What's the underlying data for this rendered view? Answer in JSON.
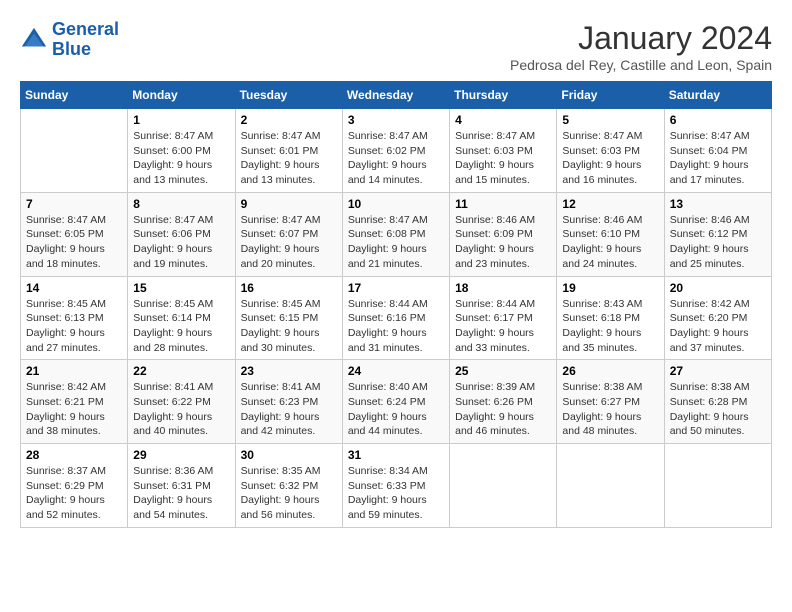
{
  "header": {
    "logo_line1": "General",
    "logo_line2": "Blue",
    "month": "January 2024",
    "location": "Pedrosa del Rey, Castille and Leon, Spain"
  },
  "days_of_week": [
    "Sunday",
    "Monday",
    "Tuesday",
    "Wednesday",
    "Thursday",
    "Friday",
    "Saturday"
  ],
  "weeks": [
    [
      {
        "day": "",
        "info": ""
      },
      {
        "day": "1",
        "info": "Sunrise: 8:47 AM\nSunset: 6:00 PM\nDaylight: 9 hours\nand 13 minutes."
      },
      {
        "day": "2",
        "info": "Sunrise: 8:47 AM\nSunset: 6:01 PM\nDaylight: 9 hours\nand 13 minutes."
      },
      {
        "day": "3",
        "info": "Sunrise: 8:47 AM\nSunset: 6:02 PM\nDaylight: 9 hours\nand 14 minutes."
      },
      {
        "day": "4",
        "info": "Sunrise: 8:47 AM\nSunset: 6:03 PM\nDaylight: 9 hours\nand 15 minutes."
      },
      {
        "day": "5",
        "info": "Sunrise: 8:47 AM\nSunset: 6:03 PM\nDaylight: 9 hours\nand 16 minutes."
      },
      {
        "day": "6",
        "info": "Sunrise: 8:47 AM\nSunset: 6:04 PM\nDaylight: 9 hours\nand 17 minutes."
      }
    ],
    [
      {
        "day": "7",
        "info": "Sunrise: 8:47 AM\nSunset: 6:05 PM\nDaylight: 9 hours\nand 18 minutes."
      },
      {
        "day": "8",
        "info": "Sunrise: 8:47 AM\nSunset: 6:06 PM\nDaylight: 9 hours\nand 19 minutes."
      },
      {
        "day": "9",
        "info": "Sunrise: 8:47 AM\nSunset: 6:07 PM\nDaylight: 9 hours\nand 20 minutes."
      },
      {
        "day": "10",
        "info": "Sunrise: 8:47 AM\nSunset: 6:08 PM\nDaylight: 9 hours\nand 21 minutes."
      },
      {
        "day": "11",
        "info": "Sunrise: 8:46 AM\nSunset: 6:09 PM\nDaylight: 9 hours\nand 23 minutes."
      },
      {
        "day": "12",
        "info": "Sunrise: 8:46 AM\nSunset: 6:10 PM\nDaylight: 9 hours\nand 24 minutes."
      },
      {
        "day": "13",
        "info": "Sunrise: 8:46 AM\nSunset: 6:12 PM\nDaylight: 9 hours\nand 25 minutes."
      }
    ],
    [
      {
        "day": "14",
        "info": "Sunrise: 8:45 AM\nSunset: 6:13 PM\nDaylight: 9 hours\nand 27 minutes."
      },
      {
        "day": "15",
        "info": "Sunrise: 8:45 AM\nSunset: 6:14 PM\nDaylight: 9 hours\nand 28 minutes."
      },
      {
        "day": "16",
        "info": "Sunrise: 8:45 AM\nSunset: 6:15 PM\nDaylight: 9 hours\nand 30 minutes."
      },
      {
        "day": "17",
        "info": "Sunrise: 8:44 AM\nSunset: 6:16 PM\nDaylight: 9 hours\nand 31 minutes."
      },
      {
        "day": "18",
        "info": "Sunrise: 8:44 AM\nSunset: 6:17 PM\nDaylight: 9 hours\nand 33 minutes."
      },
      {
        "day": "19",
        "info": "Sunrise: 8:43 AM\nSunset: 6:18 PM\nDaylight: 9 hours\nand 35 minutes."
      },
      {
        "day": "20",
        "info": "Sunrise: 8:42 AM\nSunset: 6:20 PM\nDaylight: 9 hours\nand 37 minutes."
      }
    ],
    [
      {
        "day": "21",
        "info": "Sunrise: 8:42 AM\nSunset: 6:21 PM\nDaylight: 9 hours\nand 38 minutes."
      },
      {
        "day": "22",
        "info": "Sunrise: 8:41 AM\nSunset: 6:22 PM\nDaylight: 9 hours\nand 40 minutes."
      },
      {
        "day": "23",
        "info": "Sunrise: 8:41 AM\nSunset: 6:23 PM\nDaylight: 9 hours\nand 42 minutes."
      },
      {
        "day": "24",
        "info": "Sunrise: 8:40 AM\nSunset: 6:24 PM\nDaylight: 9 hours\nand 44 minutes."
      },
      {
        "day": "25",
        "info": "Sunrise: 8:39 AM\nSunset: 6:26 PM\nDaylight: 9 hours\nand 46 minutes."
      },
      {
        "day": "26",
        "info": "Sunrise: 8:38 AM\nSunset: 6:27 PM\nDaylight: 9 hours\nand 48 minutes."
      },
      {
        "day": "27",
        "info": "Sunrise: 8:38 AM\nSunset: 6:28 PM\nDaylight: 9 hours\nand 50 minutes."
      }
    ],
    [
      {
        "day": "28",
        "info": "Sunrise: 8:37 AM\nSunset: 6:29 PM\nDaylight: 9 hours\nand 52 minutes."
      },
      {
        "day": "29",
        "info": "Sunrise: 8:36 AM\nSunset: 6:31 PM\nDaylight: 9 hours\nand 54 minutes."
      },
      {
        "day": "30",
        "info": "Sunrise: 8:35 AM\nSunset: 6:32 PM\nDaylight: 9 hours\nand 56 minutes."
      },
      {
        "day": "31",
        "info": "Sunrise: 8:34 AM\nSunset: 6:33 PM\nDaylight: 9 hours\nand 59 minutes."
      },
      {
        "day": "",
        "info": ""
      },
      {
        "day": "",
        "info": ""
      },
      {
        "day": "",
        "info": ""
      }
    ]
  ]
}
